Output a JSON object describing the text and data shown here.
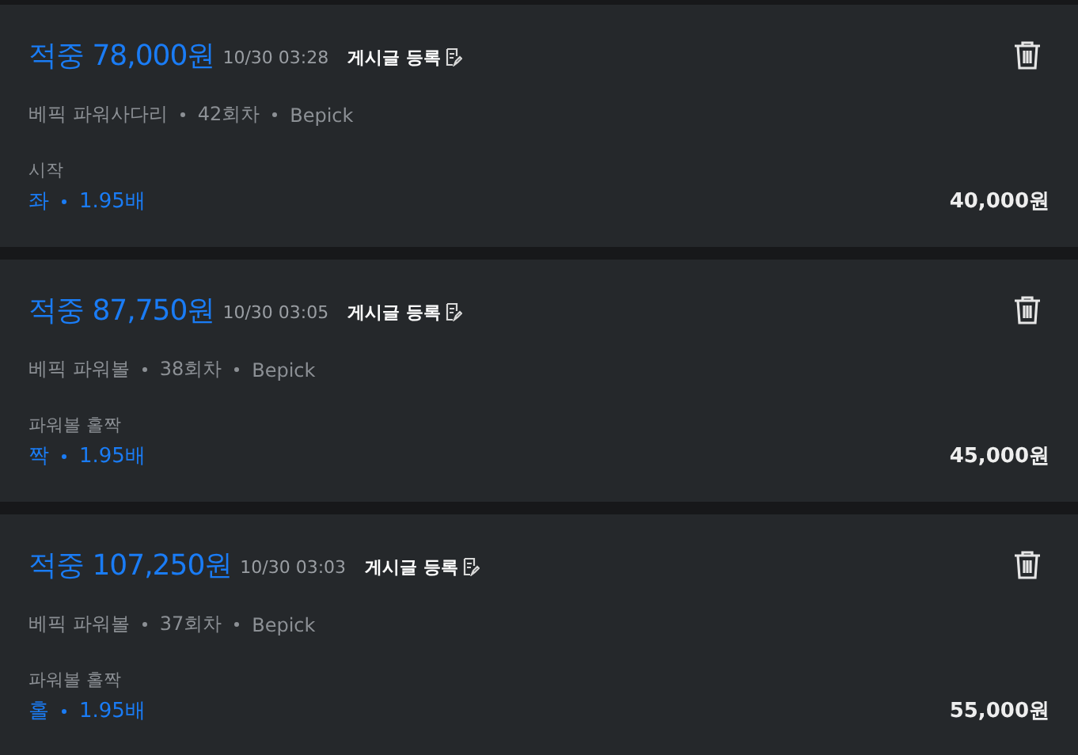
{
  "bets": [
    {
      "title": "적중 78,000원",
      "time": "10/30 03:28",
      "post_button": "게시글 등록",
      "meta": [
        "베픽 파워사다리",
        "42회차",
        "Bepick"
      ],
      "market": "시작",
      "pick": "좌",
      "odds": "1.95배",
      "stake": "40,000원"
    },
    {
      "title": "적중 87,750원",
      "time": "10/30 03:05",
      "post_button": "게시글 등록",
      "meta": [
        "베픽 파워볼",
        "38회차",
        "Bepick"
      ],
      "market": "파워볼 홀짝",
      "pick": "짝",
      "odds": "1.95배",
      "stake": "45,000원"
    },
    {
      "title": "적중 107,250원",
      "time": "10/30 03:03",
      "post_button": "게시글 등록",
      "meta": [
        "베픽 파워볼",
        "37회차",
        "Bepick"
      ],
      "market": "파워볼 홀짝",
      "pick": "홀",
      "odds": "1.95배",
      "stake": "55,000원"
    }
  ]
}
